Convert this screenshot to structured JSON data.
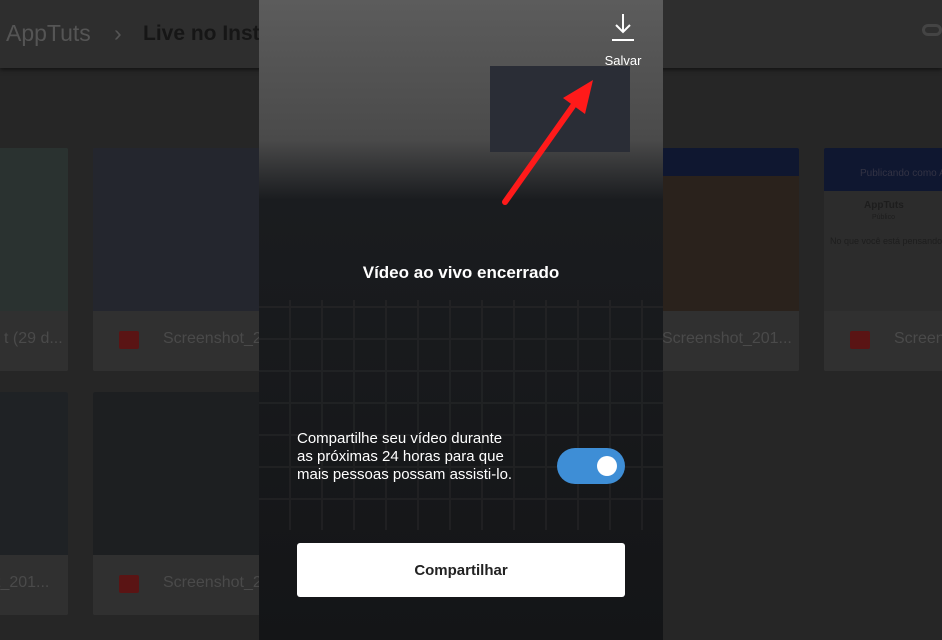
{
  "breadcrumb": {
    "root": "AppTuts",
    "current": "Live no Inst"
  },
  "files": [
    {
      "name": "t (29 d..."
    },
    {
      "name": "Screenshot_2..."
    },
    {
      "name": "Screenshot_201..."
    },
    {
      "name": "Screen..."
    },
    {
      "name": "t_201..."
    },
    {
      "name": "Screenshot_2..."
    }
  ],
  "preview_card": {
    "app": "AppTuts",
    "privacy": "Público",
    "prompt": "No que você está pensando",
    "header": "Publicando como A"
  },
  "overlay": {
    "save_label": "Salvar",
    "title": "Vídeo ao vivo encerrado",
    "description": "Compartilhe seu vídeo durante as próximas 24 horas para que mais pessoas possam assisti-lo.",
    "toggle_on": true,
    "share_button": "Compartilhar",
    "accent": "#3e8ed6",
    "arrow_color": "#ff1a1a"
  }
}
